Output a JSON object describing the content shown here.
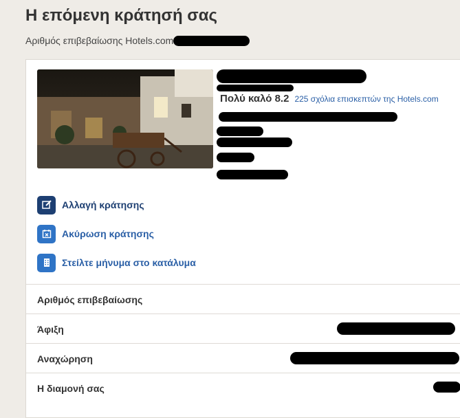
{
  "page": {
    "title": "Η επόμενη κράτησή σας",
    "confirmation_prefix": "Αριθμός επιβεβαίωσης Hotels.com"
  },
  "hotel": {
    "rating_text": "Πολύ καλό 8.2",
    "reviews_link": "225 σχόλια επισκεπτών της Hotels.com",
    "image_alt": "Hotel courtyard at night with wooden cart"
  },
  "actions": [
    {
      "label": "Αλλαγή κράτησης",
      "icon": "edit-icon"
    },
    {
      "label": "Ακύρωση κράτησης",
      "icon": "cancel-calendar-icon"
    },
    {
      "label": "Στείλτε μήνυμα στο κατάλυμα",
      "icon": "building-icon"
    }
  ],
  "details": [
    {
      "label": "Αριθμός επιβεβαίωσης"
    },
    {
      "label": "Άφιξη"
    },
    {
      "label": "Αναχώρηση"
    },
    {
      "label": "Η διαμονή σας"
    }
  ],
  "colors": {
    "link": "#2a5fa6",
    "icon_dark": "#1d3f72",
    "icon_light": "#2f74c6",
    "background": "#efece7"
  }
}
